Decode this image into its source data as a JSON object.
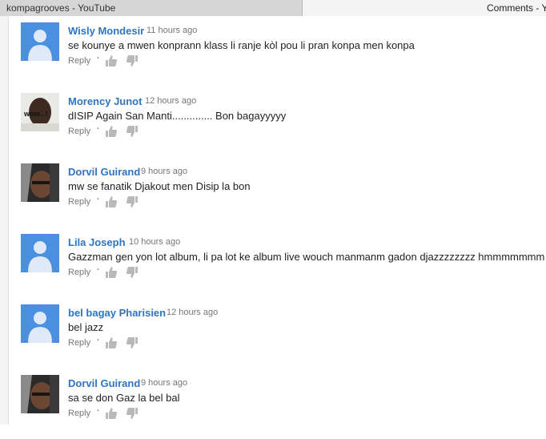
{
  "tabs": {
    "left_title": "kompagrooves - YouTube",
    "right_title": "Comments - Y"
  },
  "reply_label": "Reply",
  "separator": "·",
  "colors": {
    "author": "#2f74c0",
    "avatar_default_bg": "#4a8fe0",
    "avatar_default_fg": "#dfe9f7",
    "meta": "#767676"
  },
  "comments": [
    {
      "author": "Wisly Mondesir",
      "time": "11 hours ago",
      "text": "se kounye a mwen konprann klass li ranje kòl pou li pran konpa men konpa",
      "avatar": "default-avatar-icon"
    },
    {
      "author": "Morency Junot",
      "time": "12 hours ago",
      "text": "dISIP Again San Manti.............. Bon bagayyyyy",
      "avatar": "photo-avatar",
      "avatar_caption": "wow...!"
    },
    {
      "author": "Dorvil Guirand",
      "time": "9 hours ago",
      "text": "mw se fanatik Djakout men Disip la bon",
      "avatar": "photo-avatar"
    },
    {
      "author": "Lila Joseph",
      "time": "10 hours ago",
      "text": "Gazzman gen yon lot album, li pa lot ke album live wouch manmanm gadon djazzzzzzzz hmmmmmmm",
      "avatar": "default-avatar-icon"
    },
    {
      "author": "bel bagay Pharisien",
      "time": "12 hours ago",
      "text": "bel jazz",
      "avatar": "default-avatar-icon"
    },
    {
      "author": "Dorvil Guirand",
      "time": "9 hours ago",
      "text": "sa se don Gaz la bel bal",
      "avatar": "photo-avatar"
    }
  ]
}
